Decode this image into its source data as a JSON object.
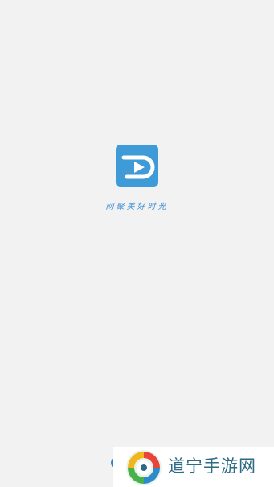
{
  "splash": {
    "tagline": "网聚美好时光",
    "logo_icon": "play-logo-icon",
    "accent_color": "#3f9ad8"
  },
  "watermark": {
    "text": "道宁手游网",
    "logo_icon": "swirl-logo-icon",
    "text_color": "#2c6a86"
  }
}
